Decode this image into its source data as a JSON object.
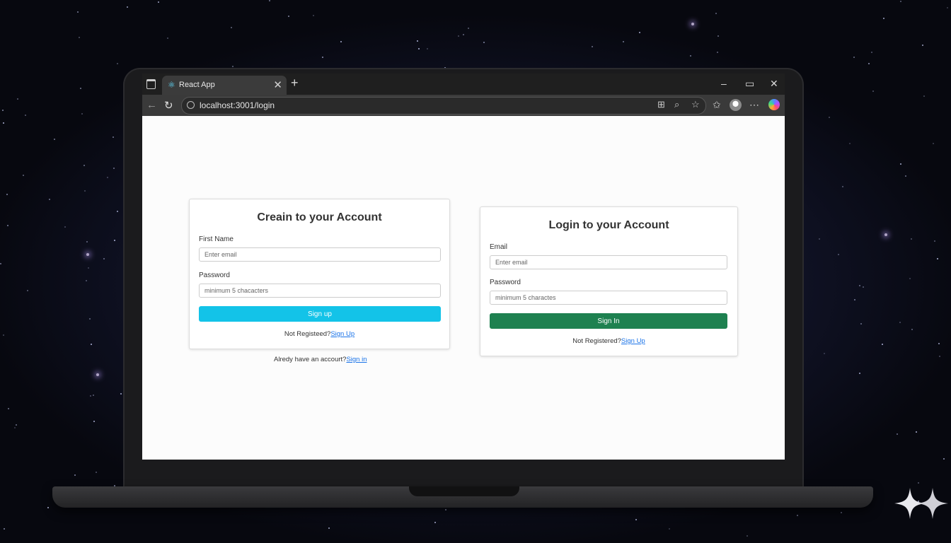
{
  "browser": {
    "tab_title": "React App",
    "url": "localhost:3001/login",
    "new_tab_label": "+",
    "tab_close_label": "✕"
  },
  "signup_form": {
    "title": "Creain to your Account",
    "first_name_label": "First Name",
    "first_name_placeholder": "Enter email",
    "password_label": "Password",
    "password_placeholder": "minimum 5 chacacters",
    "button_label": "Sign up",
    "button_color": "#13c3e8",
    "footer_text": "Not Registeed?",
    "footer_link": "Sign Up"
  },
  "signup_below": {
    "text": "Alredy have an accourt?",
    "link": "Sign in"
  },
  "login_form": {
    "title": "Login to your Account",
    "email_label": "Email",
    "email_placeholder": "Enter email",
    "password_label": "Password",
    "password_placeholder": "minimum 5 charactes",
    "button_label": "Sign In",
    "button_color": "#1e8150",
    "footer_text": "Not Registered?",
    "footer_link": "Sign Up"
  }
}
